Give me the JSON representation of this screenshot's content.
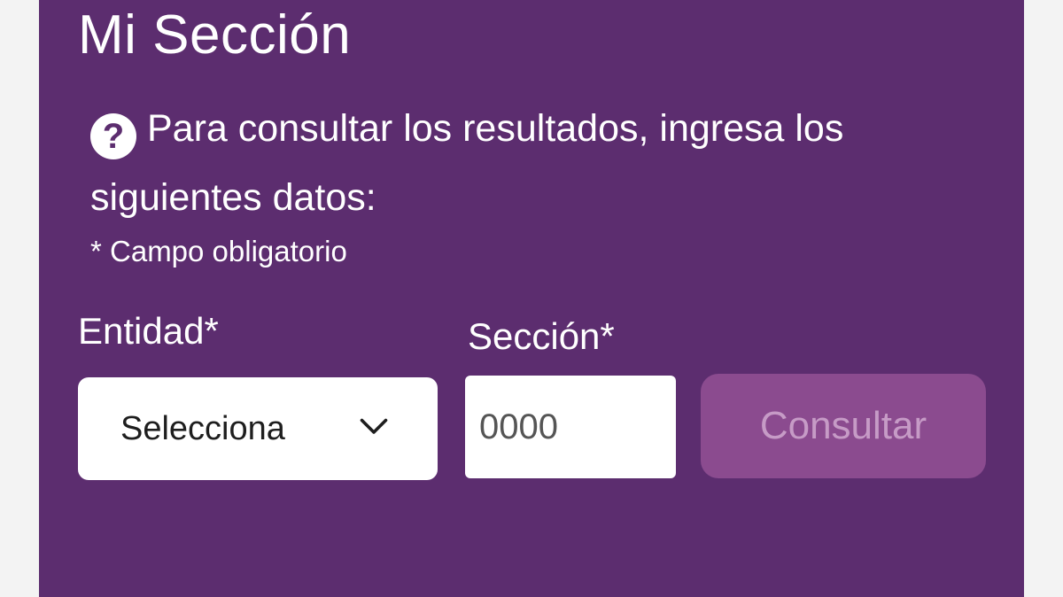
{
  "title": "Mi Sección",
  "info": {
    "icon": "help-icon",
    "text": "Para consultar los resultados, ingresa los siguientes datos:"
  },
  "required_note": "* Campo obligatorio",
  "form": {
    "entidad_label": "Entidad*",
    "entidad_value": "Selecciona",
    "seccion_label": "Sección*",
    "seccion_placeholder": "0000",
    "submit_label": "Consultar"
  },
  "colors": {
    "panel": "#5c2d6f",
    "button": "#8b4b8f",
    "button_text": "#c69bc6"
  }
}
